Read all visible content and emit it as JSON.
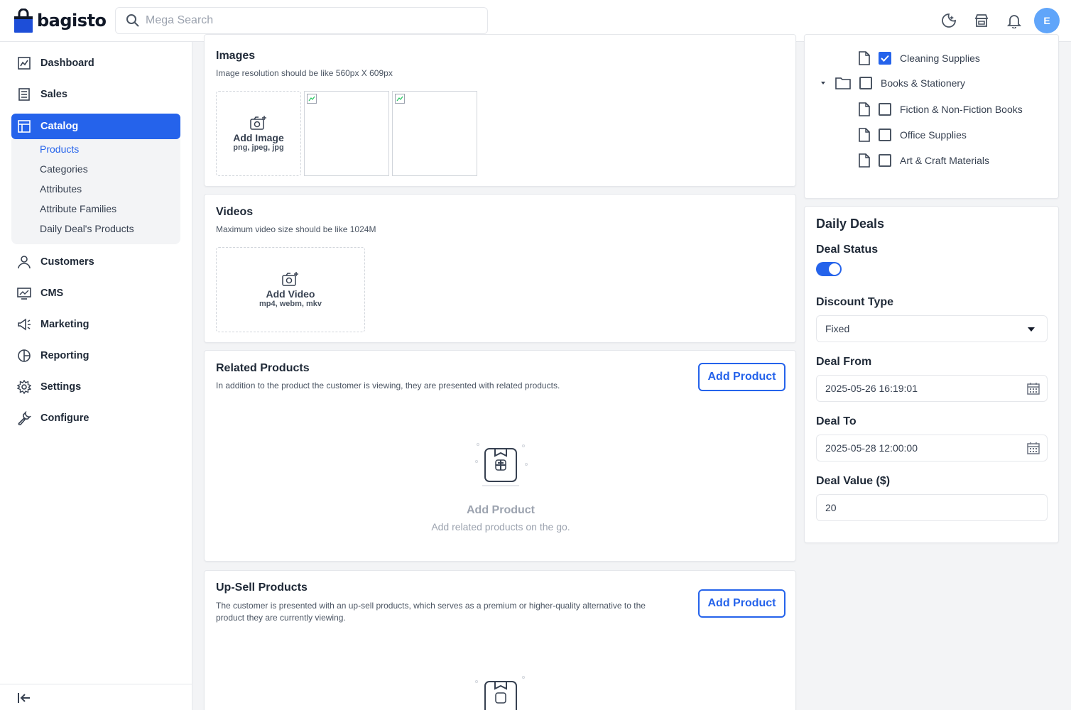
{
  "header": {
    "logo_text": "bagisto",
    "search_placeholder": "Mega Search",
    "avatar_initial": "E"
  },
  "sidebar": {
    "items": [
      {
        "label": "Dashboard",
        "icon": "dashboard-icon"
      },
      {
        "label": "Sales",
        "icon": "sales-icon"
      },
      {
        "label": "Catalog",
        "icon": "catalog-icon",
        "active": true
      },
      {
        "label": "Customers",
        "icon": "customers-icon"
      },
      {
        "label": "CMS",
        "icon": "cms-icon"
      },
      {
        "label": "Marketing",
        "icon": "marketing-icon"
      },
      {
        "label": "Reporting",
        "icon": "reporting-icon"
      },
      {
        "label": "Settings",
        "icon": "settings-icon"
      },
      {
        "label": "Configure",
        "icon": "configure-icon"
      }
    ],
    "catalog_sub": [
      "Products",
      "Categories",
      "Attributes",
      "Attribute Families",
      "Daily Deal's Products"
    ]
  },
  "images": {
    "title": "Images",
    "desc": "Image resolution should be like 560px X 609px",
    "add_label": "Add Image",
    "add_hint": "png, jpeg, jpg"
  },
  "videos": {
    "title": "Videos",
    "desc": "Maximum video size should be like 1024M",
    "add_label": "Add Video",
    "add_hint": "mp4, webm, mkv"
  },
  "related": {
    "title": "Related Products",
    "desc": "In addition to the product the customer is viewing, they are presented with related products.",
    "button": "Add Product",
    "empty_title": "Add Product",
    "empty_sub": "Add related products on the go."
  },
  "upsell": {
    "title": "Up-Sell Products",
    "desc_line1": "The customer is presented with an up-sell products, which serves as a premium or higher-quality alternative to the",
    "desc_line2": "product they are currently viewing.",
    "button": "Add Product"
  },
  "categories": {
    "items": [
      {
        "label": "Cleaning Supplies",
        "checked": true
      },
      {
        "label": "Books & Stationery",
        "checked": false
      },
      {
        "label": "Fiction & Non-Fiction Books",
        "checked": false
      },
      {
        "label": "Office Supplies",
        "checked": false
      },
      {
        "label": "Art & Craft Materials",
        "checked": false
      }
    ]
  },
  "daily_deals": {
    "title": "Daily Deals",
    "status_label": "Deal Status",
    "status_on": true,
    "discount_label": "Discount Type",
    "discount_value": "Fixed",
    "from_label": "Deal From",
    "from_value": "2025-05-26 16:19:01",
    "to_label": "Deal To",
    "to_value": "2025-05-28 12:00:00",
    "value_label": "Deal Value ($)",
    "value_value": "20"
  }
}
